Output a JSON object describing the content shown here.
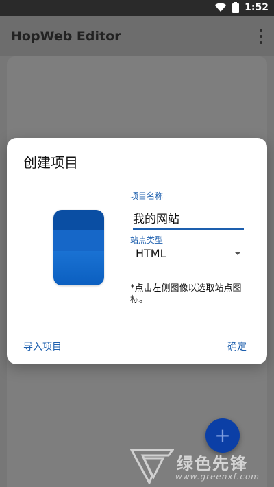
{
  "status_bar": {
    "time": "1:52",
    "wifi_icon": "wifi-icon",
    "battery_icon": "battery-icon"
  },
  "app_bar": {
    "title": "HopWeb Editor",
    "menu_icon": "more-vert-icon"
  },
  "dialog": {
    "title": "创建项目",
    "name_label": "项目名称",
    "name_value": "我的网站",
    "type_label": "站点类型",
    "type_value": "HTML",
    "hint": "*点击左侧图像以选取站点图标。",
    "import_button": "导入项目",
    "confirm_button": "确定"
  },
  "fab": {
    "icon": "plus-icon",
    "label": "+"
  },
  "watermark": {
    "text": "绿色先锋",
    "url": "www.greenxf.com"
  },
  "colors": {
    "accent": "#1d5fae",
    "fab": "#0b3fa6",
    "scrim": "#777777"
  }
}
